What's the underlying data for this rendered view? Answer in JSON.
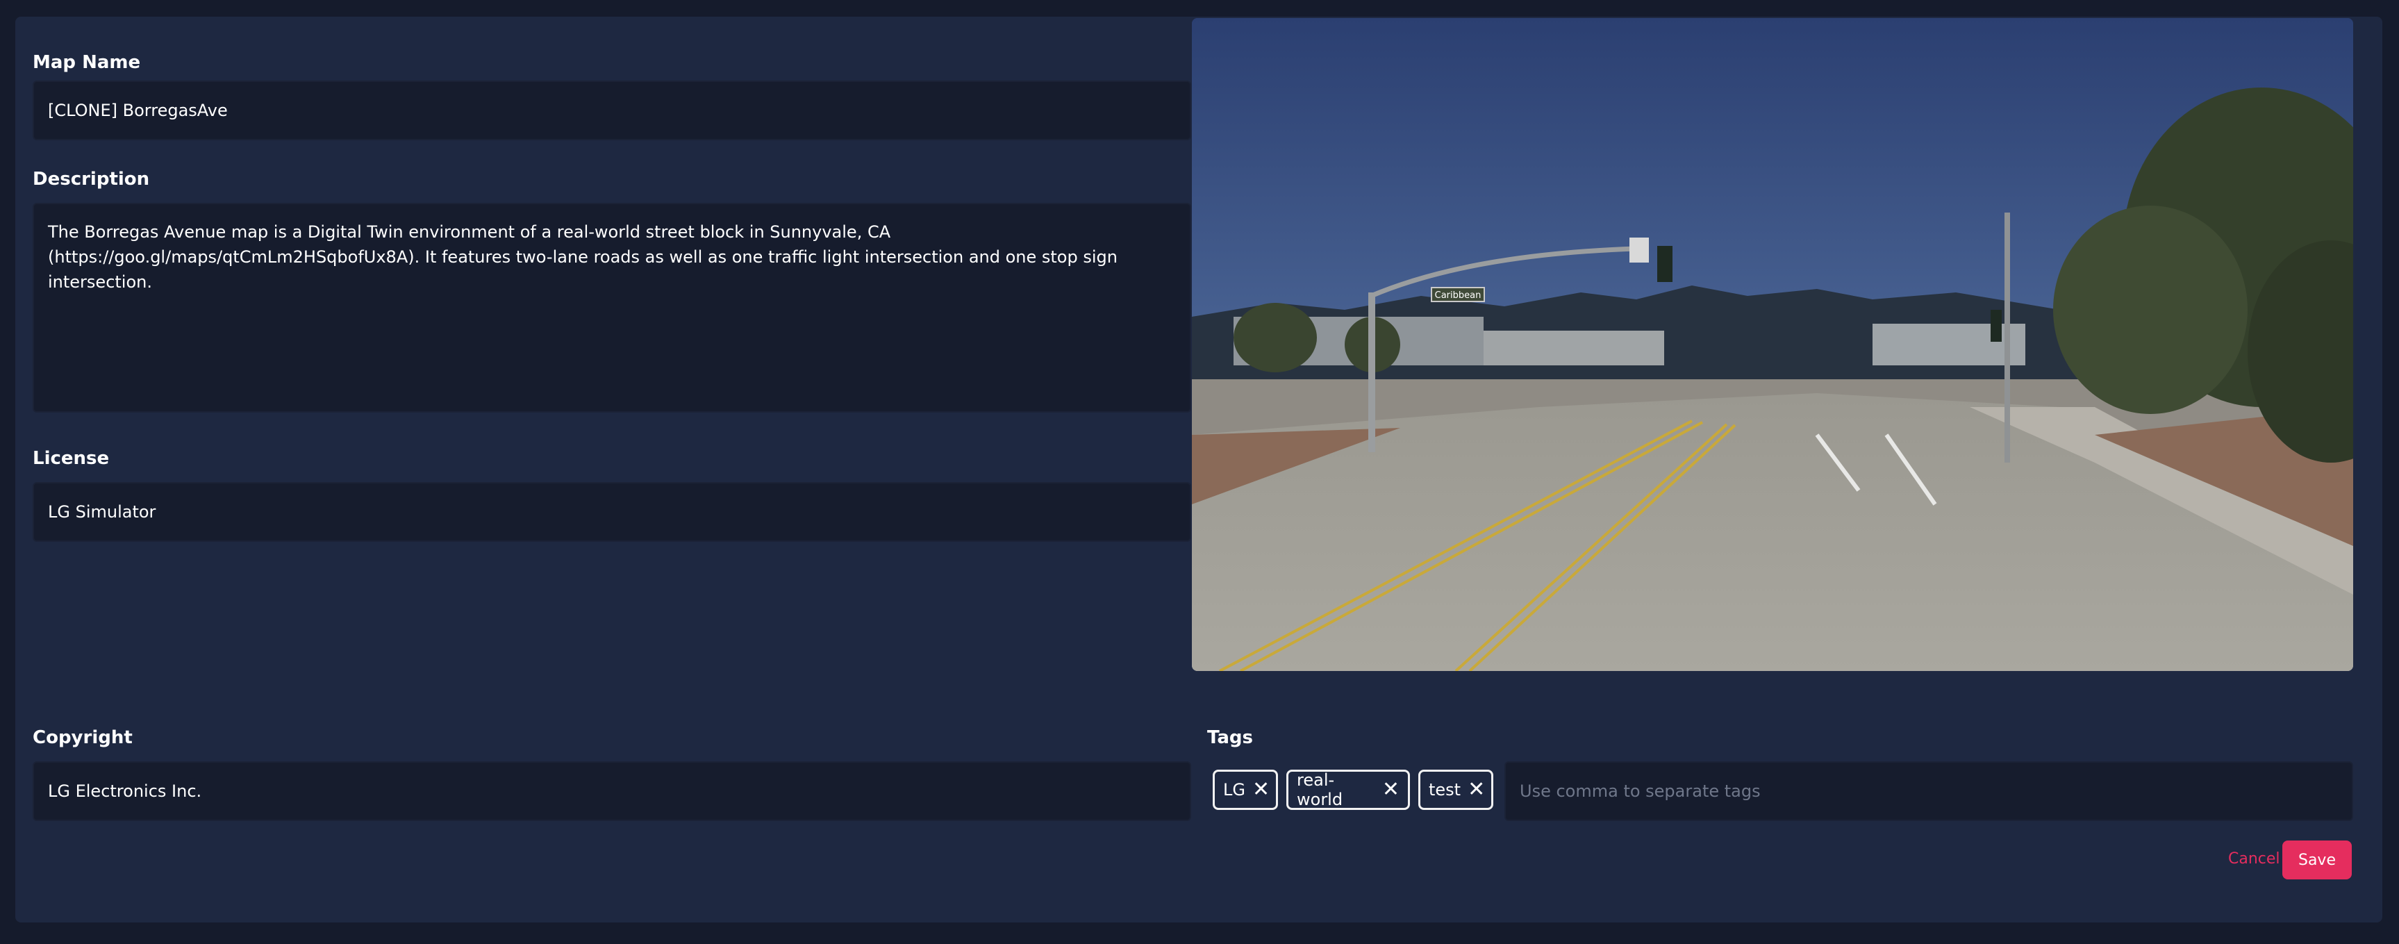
{
  "form": {
    "map_name": {
      "label": "Map Name",
      "value": "[CLONE] BorregasAve"
    },
    "description": {
      "label": "Description",
      "value": "The Borregas Avenue map is a Digital Twin environment of a real-world street block in Sunnyvale, CA\n(https://goo.gl/maps/qtCmLm2HSqbofUx8A). It features two-lane roads as well as one traffic light intersection and one stop sign intersection."
    },
    "license": {
      "label": "License",
      "value": "LG Simulator"
    },
    "copyright": {
      "label": "Copyright",
      "value": "LG Electronics Inc."
    },
    "tags": {
      "label": "Tags",
      "items": [
        "LG",
        "real-world",
        "test"
      ],
      "remove_icon": "close-icon",
      "placeholder": "Use comma to separate tags"
    }
  },
  "preview": {
    "street_sign": "Caribbean"
  },
  "actions": {
    "cancel_label": "Cancel",
    "save_label": "Save"
  },
  "colors": {
    "background": "#151b2c",
    "panel": "#1e2841",
    "field": "#161c2d",
    "accent": "#e52d5e"
  }
}
